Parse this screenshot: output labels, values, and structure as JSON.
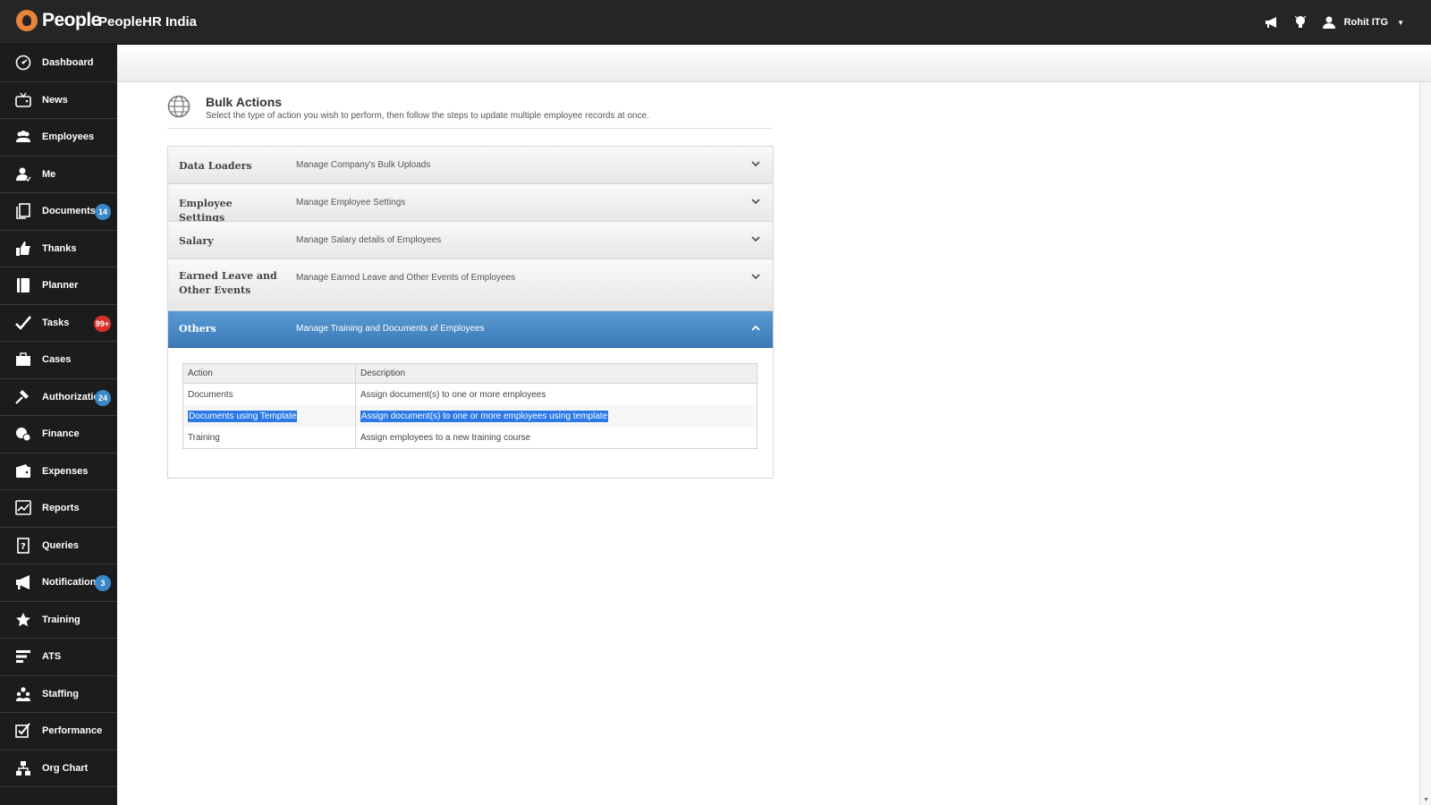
{
  "header": {
    "brand": "People",
    "company": "PeopleHR India",
    "user": "Rohit ITG",
    "icons": [
      "megaphone-icon",
      "lightbulb-icon",
      "user-icon",
      "caret-down-icon"
    ]
  },
  "sidebar": {
    "items": [
      {
        "label": "Dashboard",
        "icon": "dashboard-icon"
      },
      {
        "label": "News",
        "icon": "tv-icon"
      },
      {
        "label": "Employees",
        "icon": "people-icon"
      },
      {
        "label": "Me",
        "icon": "person-icon"
      },
      {
        "label": "Documents",
        "icon": "documents-icon",
        "badge": "14"
      },
      {
        "label": "Thanks",
        "icon": "thumbs-up-icon"
      },
      {
        "label": "Planner",
        "icon": "planner-icon"
      },
      {
        "label": "Tasks",
        "icon": "check-icon",
        "badge": "99+"
      },
      {
        "label": "Cases",
        "icon": "briefcase-icon"
      },
      {
        "label": "Authorizations",
        "icon": "gavel-icon",
        "badge": "24"
      },
      {
        "label": "Finance",
        "icon": "coins-icon"
      },
      {
        "label": "Expenses",
        "icon": "wallet-icon"
      },
      {
        "label": "Reports",
        "icon": "chart-icon"
      },
      {
        "label": "Queries",
        "icon": "question-icon"
      },
      {
        "label": "Notifications",
        "icon": "megaphone-icon",
        "badge": "3"
      },
      {
        "label": "Training",
        "icon": "star-icon"
      },
      {
        "label": "ATS",
        "icon": "bars-icon"
      },
      {
        "label": "Staffing",
        "icon": "staffing-icon"
      },
      {
        "label": "Performance",
        "icon": "checkbox-icon"
      },
      {
        "label": "Org Chart",
        "icon": "org-chart-icon"
      }
    ],
    "colors": {
      "blue_badge": "#3a87c8",
      "red_badge": "#d9302a"
    }
  },
  "page": {
    "title": "Bulk Actions",
    "subtitle": "Select the type of action you wish to perform, then follow the steps to update multiple employee records at once."
  },
  "accordion": {
    "sections": [
      {
        "title": "Data Loaders",
        "description": "Manage Company's Bulk Uploads",
        "expanded": false
      },
      {
        "title": "Employee Settings",
        "description": "Manage Employee Settings",
        "expanded": false
      },
      {
        "title": "Salary",
        "description": "Manage Salary details of Employees",
        "expanded": false
      },
      {
        "title": "Earned Leave and Other Events",
        "description": "Manage Earned Leave and Other Events of Employees",
        "expanded": false
      },
      {
        "title": "Others",
        "description": "Manage Training and Documents of Employees",
        "expanded": true
      }
    ],
    "table": {
      "headers": [
        "Action",
        "Description"
      ],
      "rows": [
        {
          "action": "Documents",
          "description": "Assign document(s) to one or more employees",
          "selected": false
        },
        {
          "action": "Documents using Template",
          "description": "Assign document(s) to one or more employees using template",
          "selected": true
        },
        {
          "action": "Training",
          "description": "Assign employees to a new training course",
          "selected": false
        }
      ]
    },
    "active_color": "#4a8ac6"
  }
}
